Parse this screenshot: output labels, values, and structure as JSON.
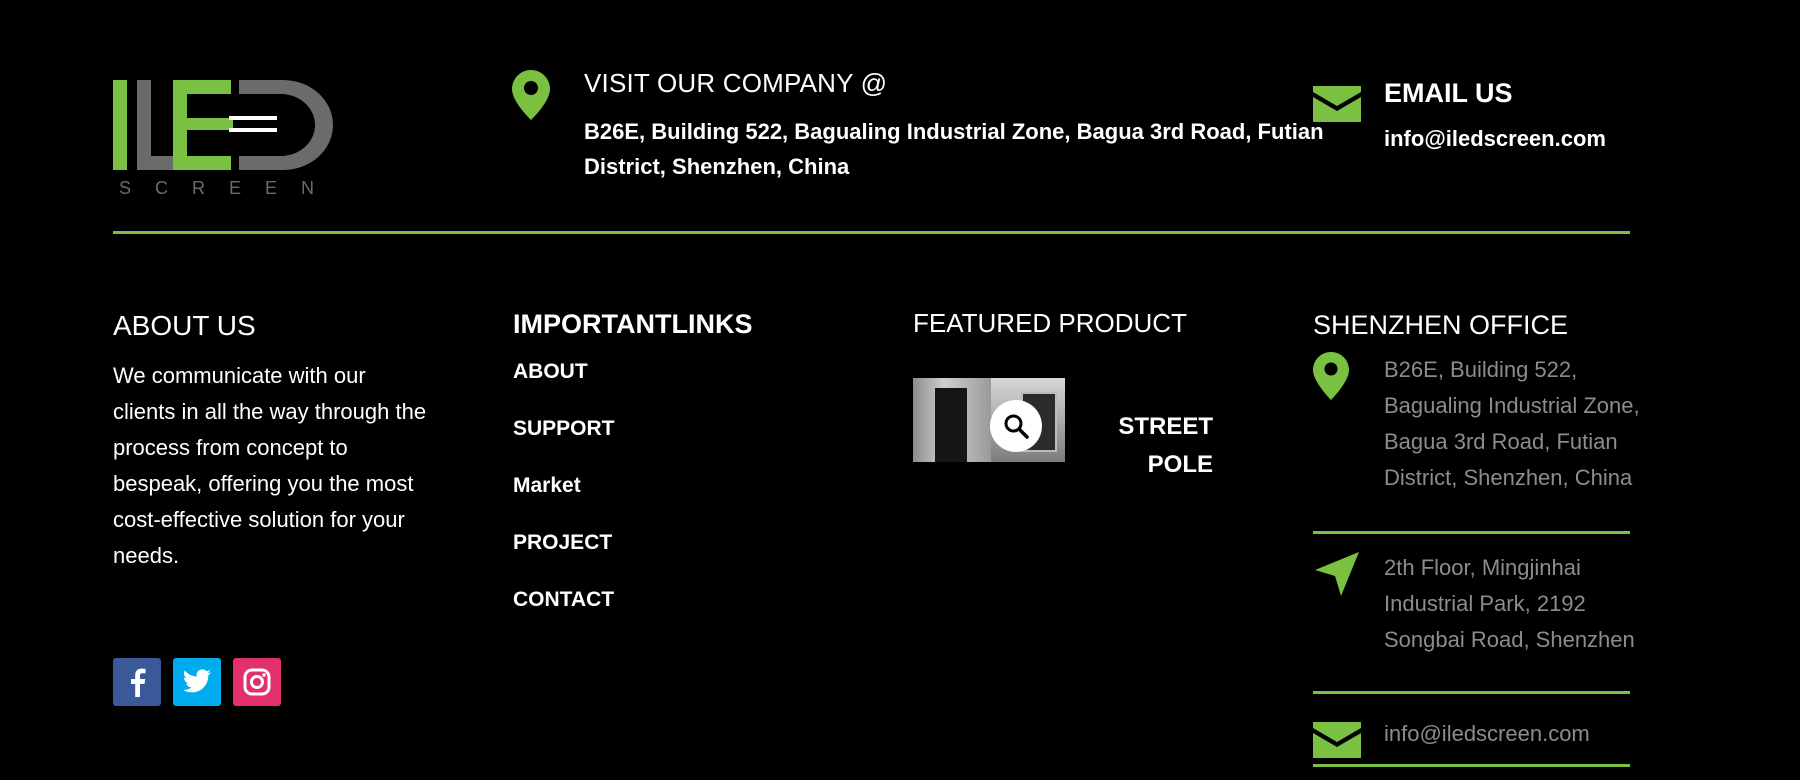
{
  "logo": {
    "text": "ILED",
    "subtext": "SCREEN",
    "colors": {
      "green": "#7ac142",
      "grey": "#6b6b6b"
    }
  },
  "top": {
    "visit_title": "VISIT OUR COMPANY @",
    "visit_address": "B26E, Building 522, Bagualing Industrial Zone, Bagua 3rd Road, Futian District, Shenzhen, China",
    "email_title": "EMAIL US",
    "email_value": "info@iledscreen.com"
  },
  "about": {
    "title": "ABOUT US",
    "text": "We communicate with our clients in all the way through the process from concept to bespeak, offering you the most cost-effective solution for your needs."
  },
  "links": {
    "title": "IMPORTANTLINKS",
    "items": [
      {
        "label": "ABOUT"
      },
      {
        "label": "SUPPORT"
      },
      {
        "label": "Market"
      },
      {
        "label": "PROJECT"
      },
      {
        "label": "CONTACT"
      }
    ]
  },
  "featured": {
    "title": "FEATURED PRODUCT",
    "product_name": "STREET POLE",
    "zoom_icon": "search-icon"
  },
  "office": {
    "title": "SHENZHEN OFFICE",
    "address1": "B26E, Building 522, Bagualing Industrial Zone, Bagua 3rd Road, Futian District, Shenzhen, China",
    "address2": "2th Floor, Mingjinhai Industrial Park, 2192 Songbai Road, Shenzhen",
    "email": "info@iledscreen.com"
  },
  "social": [
    {
      "name": "facebook-icon",
      "color": "#3b5998"
    },
    {
      "name": "twitter-icon",
      "color": "#00acee"
    },
    {
      "name": "instagram-icon",
      "color": "#e1306c"
    }
  ],
  "colors": {
    "accent": "#7ac142",
    "muted_text": "#8c8c8c",
    "background": "#000000"
  }
}
